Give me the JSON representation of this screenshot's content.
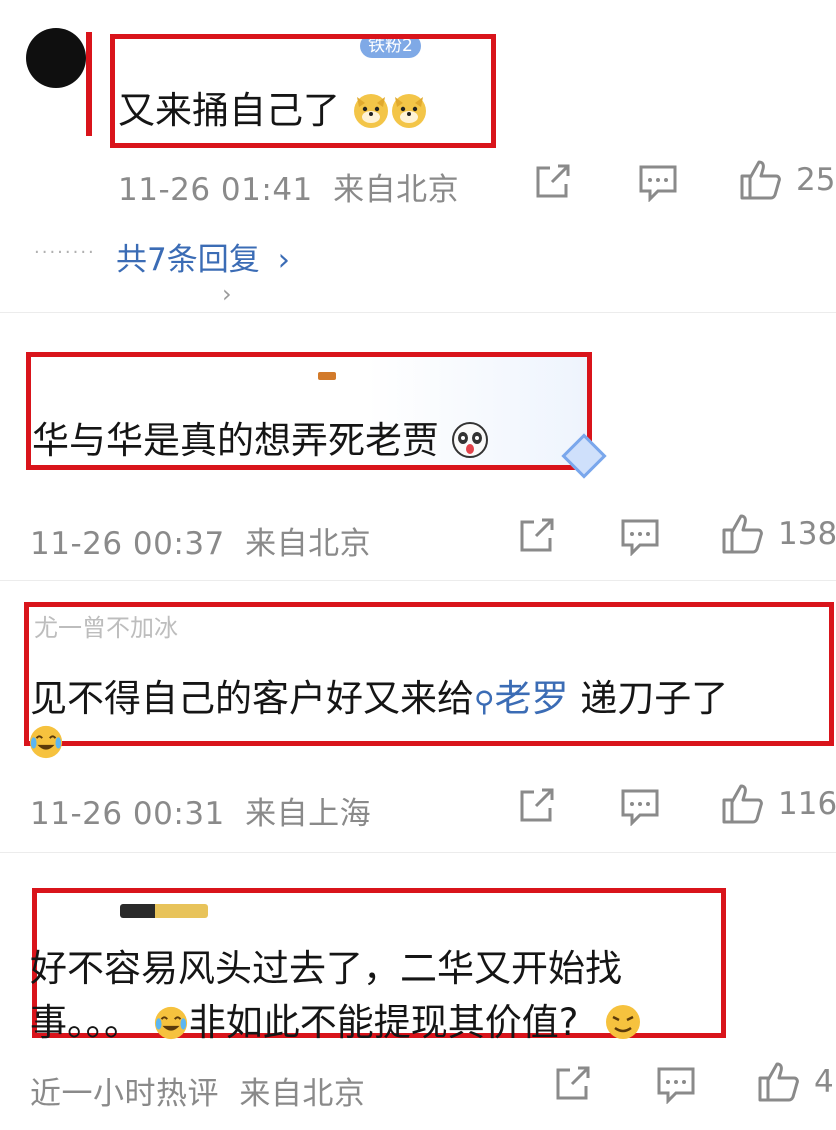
{
  "comments": [
    {
      "badge": "铁粉2",
      "text": "又来捅自己了",
      "time": "11-26 01:41",
      "location": "来自北京",
      "likes": "25",
      "replies_link": "共7条回复"
    },
    {
      "text": "华与华是真的想弄死老贾",
      "time": "11-26 00:37",
      "location": "来自北京",
      "likes": "138"
    },
    {
      "username_partial": "尤一曾不加冰",
      "text_before": "见不得自己的客户好又来给",
      "mention": "老罗",
      "text_after": " 递刀子了",
      "time": "11-26 00:31",
      "location": "来自上海",
      "likes": "116"
    },
    {
      "text_line1": "好不容易风头过去了，二华又开始找",
      "text_line2_a": "事。。。",
      "text_line2_b": "非如此不能提现其价值?",
      "time": "近一小时热评",
      "location": "来自北京",
      "likes": "4"
    }
  ],
  "colors": {
    "highlight_box": "#d9141b",
    "link": "#3b6cb5",
    "meta": "#8a8a8a"
  },
  "icons": [
    "share-icon",
    "comment-icon",
    "like-icon",
    "search-icon",
    "chevron-right-icon",
    "emoji-doge",
    "emoji-panda",
    "emoji-crying-laugh",
    "emoji-smirk"
  ]
}
